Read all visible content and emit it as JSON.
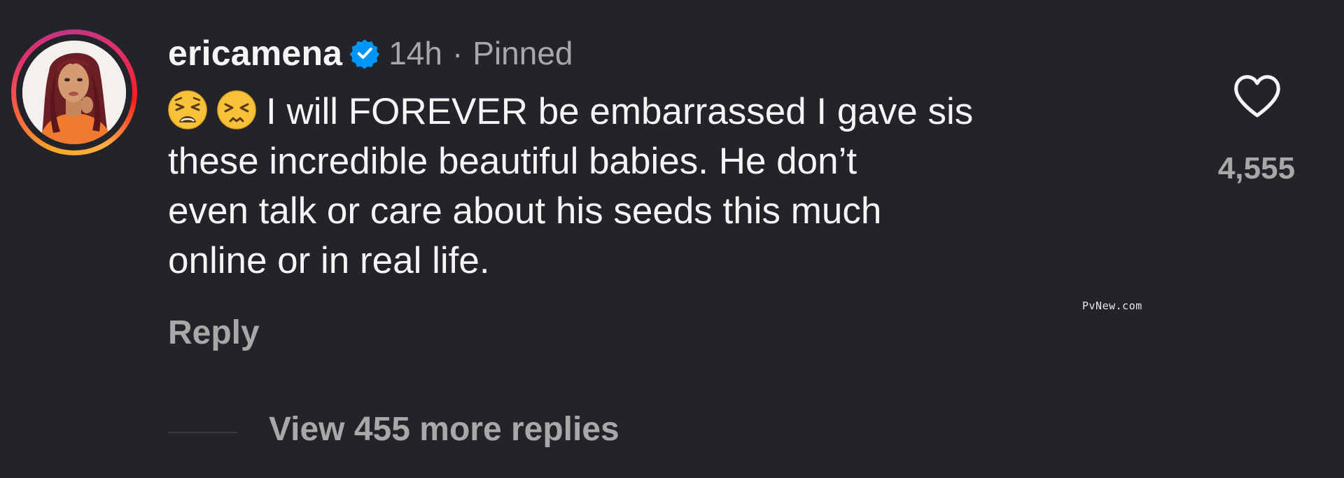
{
  "comment": {
    "username": "ericamena",
    "time": "14h",
    "separator": "·",
    "pinned_label": "Pinned",
    "text_lines": [
      "I will FOREVER be embarrassed I gave sis",
      "these incredible beautiful babies. He don’t",
      "even talk or care about his seeds this much",
      "online or in real life."
    ],
    "emojis": [
      "tired-face-emoji",
      "persevering-face-emoji"
    ],
    "like_count": "4,555",
    "reply_label": "Reply",
    "view_replies_label": "View 455 more replies"
  },
  "watermark": "PvNew.com",
  "icons": {
    "verified": "verified-badge-icon",
    "like": "heart-outline-icon"
  },
  "colors": {
    "background": "#222429",
    "primary_text": "#f5f5f5",
    "secondary_text": "#a8a8a8",
    "verified_blue": "#0095f6"
  }
}
